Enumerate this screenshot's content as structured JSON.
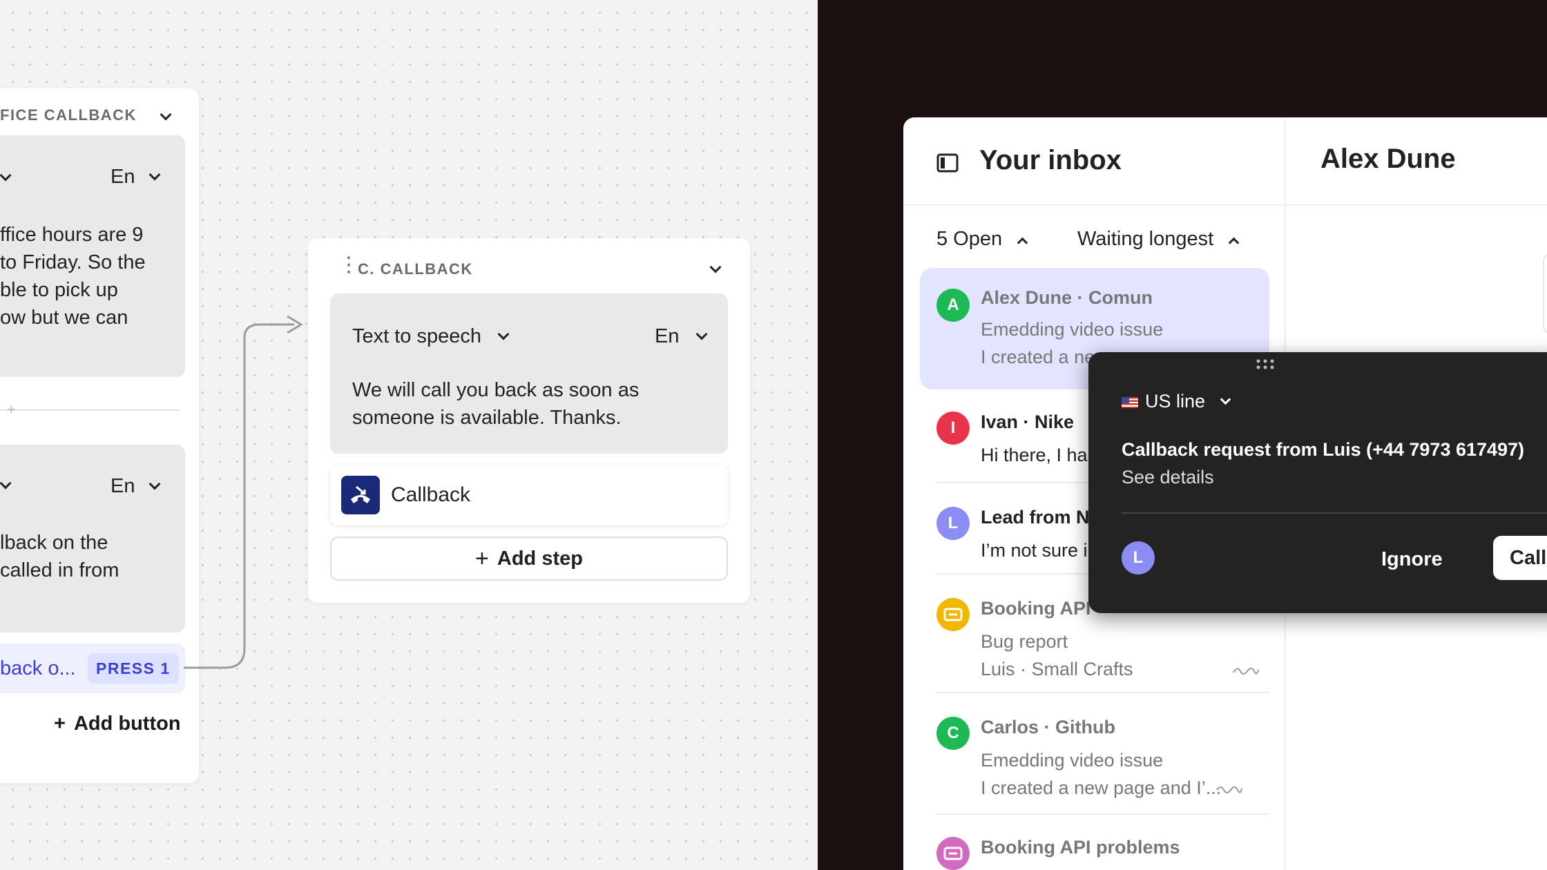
{
  "flow": {
    "office_card": {
      "header": "FICE CALLBACK",
      "block1": {
        "lang": "En",
        "text": [
          "ffice hours are 9",
          "to Friday. So the",
          "ble to pick up",
          "ow but we can"
        ]
      },
      "block2": {
        "lang": "En",
        "text": [
          "lback on the",
          "called in from"
        ]
      },
      "option": {
        "label": "back o...",
        "press": "PRESS 1"
      },
      "add_button": "Add button"
    },
    "callback_card": {
      "header": "C. CALLBACK",
      "tts_label": "Text to speech",
      "lang": "En",
      "message": [
        "We will call you back as soon as",
        "someone is available. Thanks."
      ],
      "step": "Callback",
      "add_step": "Add step"
    }
  },
  "inbox": {
    "title": "Your inbox",
    "contact_title": "Alex Dune",
    "filter_open": "5 Open",
    "sort": "Waiting longest",
    "conversations": [
      {
        "initial": "A",
        "color": "#1db954",
        "name": "Alex Dune · Comun",
        "subject": "Emedding video issue",
        "preview": "I created a ne",
        "selected": true
      },
      {
        "initial": "I",
        "color": "#e8334a",
        "name": "Ivan · Nike",
        "subject": "Hi there, I ha",
        "preview": ""
      },
      {
        "initial": "L",
        "color": "#8c8cf5",
        "name": "Lead from N",
        "subject": "I’m not sure i",
        "preview": ""
      },
      {
        "initial": "",
        "color": "#f2b700",
        "name": "Booking API",
        "subject": "Bug report",
        "preview": "Luis · Small Crafts"
      },
      {
        "initial": "C",
        "color": "#1db954",
        "name": "Carlos · Github",
        "subject": "Emedding video issue",
        "preview": "I created a new page and I’..."
      },
      {
        "initial": "",
        "color": "#d26ac2",
        "name": "Booking API problems",
        "subject": "",
        "preview": ""
      }
    ]
  },
  "call_popup": {
    "line": "US line",
    "title": "Callback request from Luis (+44 7973 617497)",
    "details": "See details",
    "avatar": "L",
    "ignore": "Ignore",
    "call": "Call"
  }
}
